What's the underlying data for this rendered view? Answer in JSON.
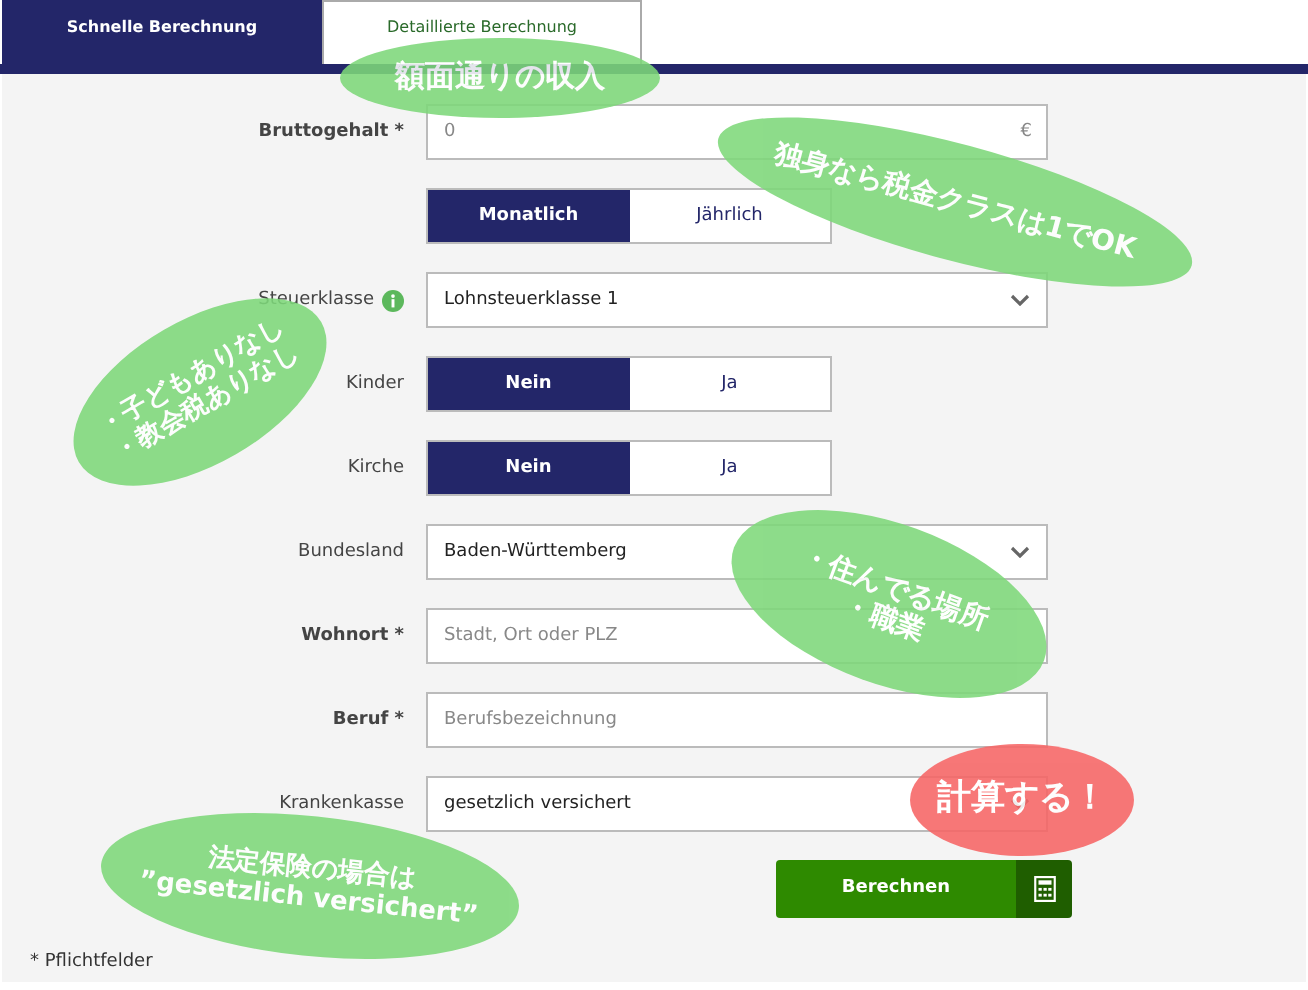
{
  "tabs": [
    {
      "label": "Schnelle Berechnung",
      "selected": true
    },
    {
      "label": "Detaillierte Berechnung",
      "selected": false
    }
  ],
  "form": {
    "rows": [
      {
        "kind": "input",
        "label": "Bruttogehalt *",
        "required": true,
        "placeholder": "0",
        "suffix": "€"
      },
      {
        "kind": "toggle",
        "options": [
          {
            "label": "Monatlich",
            "selected": true
          },
          {
            "label": "Jährlich",
            "selected": false
          }
        ]
      },
      {
        "kind": "select",
        "label": "Steuerklasse",
        "required": false,
        "info": true,
        "value": "Lohnsteuerklasse 1"
      },
      {
        "kind": "toggle",
        "label": "Kinder",
        "required": false,
        "options": [
          {
            "label": "Nein",
            "selected": true
          },
          {
            "label": "Ja",
            "selected": false
          }
        ]
      },
      {
        "kind": "toggle",
        "label": "Kirche",
        "required": false,
        "options": [
          {
            "label": "Nein",
            "selected": true
          },
          {
            "label": "Ja",
            "selected": false
          }
        ]
      },
      {
        "kind": "select",
        "label": "Bundesland",
        "required": false,
        "value": "Baden-Württemberg"
      },
      {
        "kind": "input",
        "label": "Wohnort *",
        "required": true,
        "placeholder": "Stadt, Ort oder PLZ"
      },
      {
        "kind": "input",
        "label": "Beruf *",
        "required": true,
        "placeholder": "Berufsbezeichnung"
      },
      {
        "kind": "select",
        "label": "Krankenkasse",
        "required": false,
        "value": "gesetzlich versichert"
      }
    ],
    "submit": "Berechnen",
    "footnote": "* Pflichtfelder"
  },
  "annotations": [
    {
      "lines": [
        "額面通りの収入"
      ],
      "color": "#7ed87a"
    },
    {
      "lines": [
        "独身なら税金クラスは1でOK"
      ],
      "color": "#7ed87a"
    },
    {
      "lines": [
        "・子どもありなし",
        "・教会税ありなし"
      ],
      "color": "#7ed87a"
    },
    {
      "lines": [
        "・住んでる場所",
        "・職業"
      ],
      "color": "#7ed87a"
    },
    {
      "lines": [
        "計算する！"
      ],
      "color": "#f76565"
    },
    {
      "lines": [
        "法定保険の場合は",
        "”gesetzlich versichert”"
      ],
      "color": "#7ed87a"
    }
  ]
}
